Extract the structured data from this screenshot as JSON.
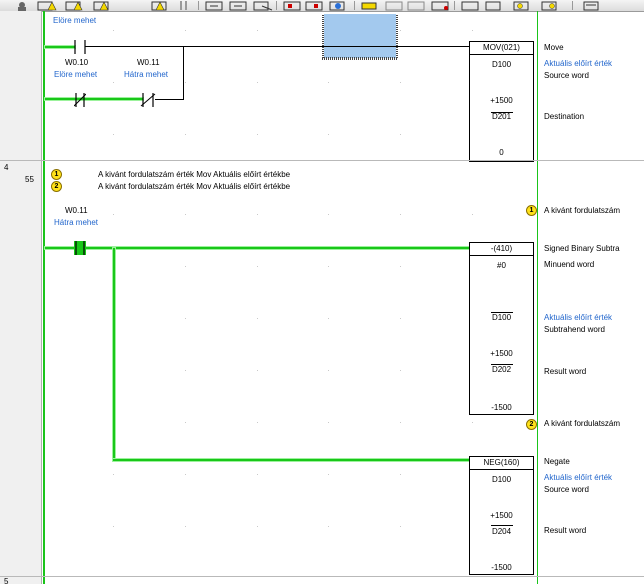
{
  "toolbar": {
    "icons": [
      "person-icon",
      "contact-warning-icon",
      "contact-warning-icon",
      "contact-warning-icon",
      "contact-warning-icon",
      "pause-icon",
      "ladder-icon",
      "ladder-icon",
      "ladder-icon",
      "network-icon",
      "network-icon",
      "network-icon",
      "network-icon",
      "network-icon",
      "network-icon",
      "network-icon",
      "network-icon",
      "network-icon",
      "stack-icon"
    ]
  },
  "rung_top": {
    "label_top": "Elöre mehet",
    "contact1_addr": "W0.10",
    "contact1_desc": "Elöre mehet",
    "contact2_addr": "W0.11",
    "contact2_desc": "Hátra mehet",
    "block": {
      "name": "MOV(021)",
      "operand1": "D100",
      "value1": "+1500",
      "operand2": "D201",
      "value2": "0"
    },
    "side": {
      "title": "Move",
      "line1": "Aktuális előírt érték",
      "line2": "Source word",
      "line3": "Destination"
    }
  },
  "rung4": {
    "number": "4",
    "step": "55",
    "comment1_id": "1",
    "comment1": "A kivánt fordulatszám érték Mov Aktuális előírt értékbe",
    "comment2_id": "2",
    "comment2": "A kivánt fordulatszám érték Mov Aktuális előírt értékbe",
    "contact_addr": "W0.11",
    "contact_desc": "Hátra mehet",
    "out_comment1": "A kivánt fordulatszám",
    "out_comment2": "A kivánt fordulatszám",
    "block1": {
      "name": "-(410)",
      "op1": "#0",
      "op2": "D100",
      "val2": "+1500",
      "op3": "D202",
      "val3": "-1500"
    },
    "side1": {
      "title": "Signed Binary Subtra",
      "line1": "Minuend word",
      "line2": "Aktuális előírt érték",
      "line3": "Subtrahend word",
      "line4": "Result word"
    },
    "block2": {
      "name": "NEG(160)",
      "op1": "D100",
      "val1": "+1500",
      "op2": "D204",
      "val2": "-1500"
    },
    "side2": {
      "title": "Negate",
      "line1": "Aktuális előírt érték",
      "line2": "Source word",
      "line3": "Result word"
    }
  },
  "rung5": {
    "number": "5"
  }
}
